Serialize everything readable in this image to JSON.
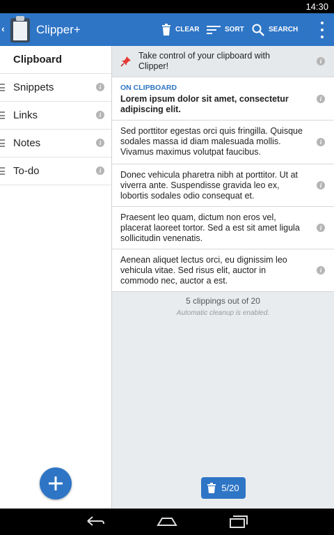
{
  "status_bar": {
    "time": "14:30"
  },
  "action_bar": {
    "title": "Clipper+",
    "clear_label": "CLEAR",
    "sort_label": "SORT",
    "search_label": "SEARCH"
  },
  "sidebar": {
    "items": [
      {
        "label": "Clipboard"
      },
      {
        "label": "Snippets"
      },
      {
        "label": "Links"
      },
      {
        "label": "Notes"
      },
      {
        "label": "To-do"
      }
    ]
  },
  "main": {
    "pinned_tip": "Take control of your clipboard with Clipper!",
    "on_clipboard_heading": "ON CLIPBOARD",
    "clippings": [
      "Lorem ipsum dolor sit amet, consectetur adipiscing elit.",
      "Sed porttitor egestas orci quis fringilla. Quisque sodales massa id diam malesuada mollis. Vivamus maximus volutpat faucibus.",
      "Donec vehicula pharetra nibh at porttitor. Ut at viverra ante. Suspendisse gravida leo ex, lobortis sodales odio consequat et.",
      "Praesent leo quam, dictum non eros vel, placerat laoreet tortor. Sed a est sit amet ligula sollicitudin venenatis.",
      "Aenean aliquet lectus orci, eu dignissim leo vehicula vitae. Sed risus elit, auctor in commodo nec, auctor a est."
    ],
    "count_text": "5 clippings out of 20",
    "cleanup_note": "Automatic cleanup is enabled.",
    "counter_label": "5/20"
  },
  "colors": {
    "accent": "#2e75c6",
    "pin": "#e53935"
  }
}
